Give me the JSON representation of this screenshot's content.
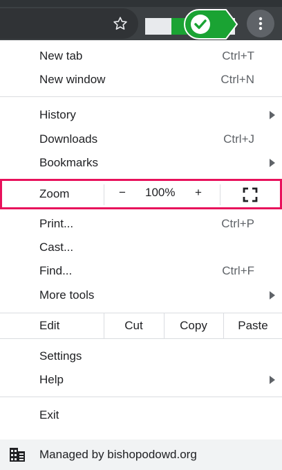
{
  "toolbar": {
    "star_icon": "star-outline-icon",
    "menu_icon": "three-dots-vertical-icon",
    "check_icon": "green-checkmark-badge-icon",
    "accent_green": "#1aa333"
  },
  "menu": {
    "group1": [
      {
        "label": "New tab",
        "shortcut": "Ctrl+T"
      },
      {
        "label": "New window",
        "shortcut": "Ctrl+N"
      }
    ],
    "group2": [
      {
        "label": "History",
        "submenu": true
      },
      {
        "label": "Downloads",
        "shortcut": "Ctrl+J"
      },
      {
        "label": "Bookmarks",
        "submenu": true
      }
    ],
    "zoom": {
      "label": "Zoom",
      "minus": "−",
      "value": "100%",
      "plus": "+",
      "fullscreen_icon": "fullscreen-icon",
      "highlight_color": "#e8115b"
    },
    "group3": [
      {
        "label": "Print...",
        "shortcut": "Ctrl+P"
      },
      {
        "label": "Cast..."
      },
      {
        "label": "Find...",
        "shortcut": "Ctrl+F"
      },
      {
        "label": "More tools",
        "submenu": true
      }
    ],
    "edit": {
      "label": "Edit",
      "cut": "Cut",
      "copy": "Copy",
      "paste": "Paste"
    },
    "group4": [
      {
        "label": "Settings"
      },
      {
        "label": "Help",
        "submenu": true
      }
    ],
    "exit": {
      "label": "Exit"
    },
    "managed": {
      "label": "Managed by bishopodowd.org",
      "icon": "building-icon"
    }
  }
}
